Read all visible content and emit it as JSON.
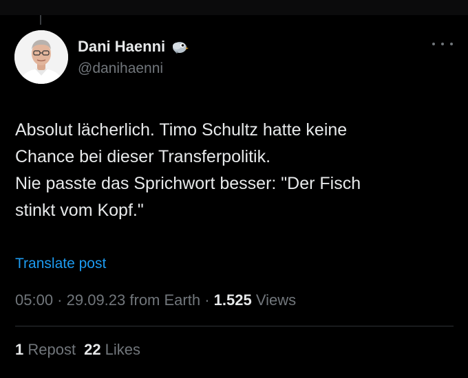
{
  "author": {
    "display_name": "Dani Haenni",
    "handle": "@danihaenni",
    "avatar_icon": "profile-photo",
    "badge_icon": "bird-emoji-icon"
  },
  "menu": {
    "more_icon": "more-horizontal-icon"
  },
  "post": {
    "lines": [
      "Absolut lächerlich. Timo Schultz hatte keine",
      "Chance bei dieser Transferpolitik.",
      "Nie passte das Sprichwort besser: \"Der Fisch",
      "stinkt vom Kopf.\""
    ],
    "translate_label": "Translate post"
  },
  "meta": {
    "time": "05:00",
    "sep1": " · ",
    "date": "29.09.23",
    "source": " from Earth",
    "sep2": " · ",
    "views_count": "1.525",
    "views_label": " Views"
  },
  "stats": {
    "reposts_count": "1",
    "reposts_label": " Repost",
    "likes_count": "22",
    "likes_label": " Likes"
  },
  "colors": {
    "background": "#000000",
    "text_primary": "#e7e9ea",
    "text_secondary": "#71767b",
    "link": "#1d9bf0",
    "divider": "#2f3336"
  }
}
